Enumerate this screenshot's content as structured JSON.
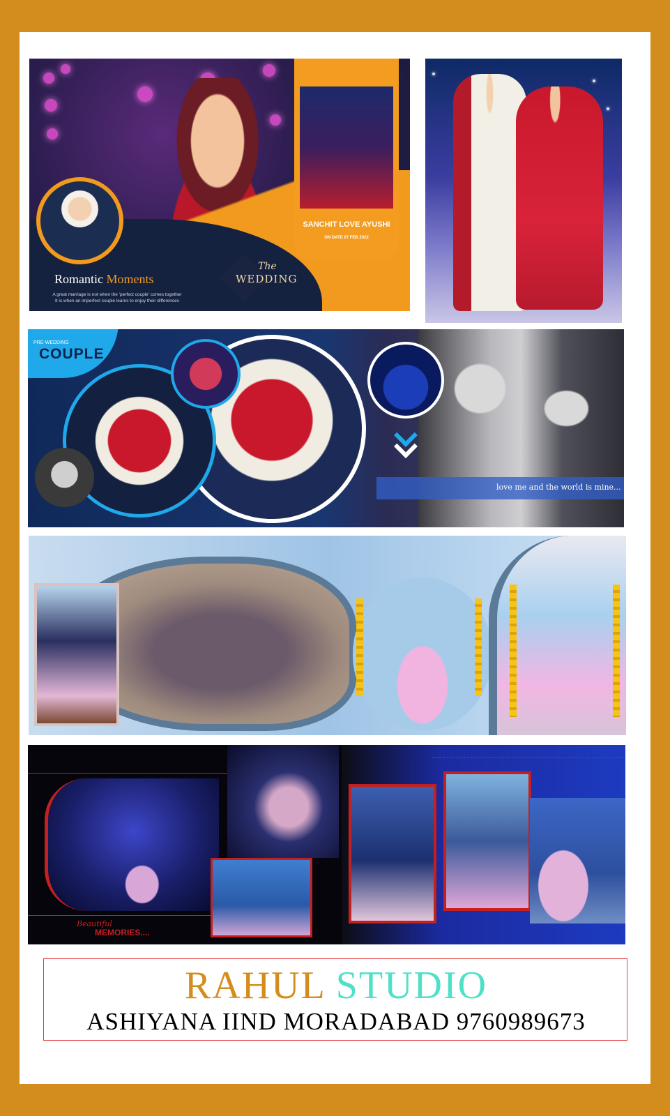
{
  "panel1": {
    "romantic_word": "Romantic",
    "moments_word": "Moments",
    "quote_line1": "A great marriage is not when the 'perfect couple' comes together",
    "quote_line2": "It is when an imperfect couple learns to enjoy their differences",
    "card_title": "SANCHIT LOVE AYUSHI",
    "card_date": "ON DATE 07 FEB 2022",
    "wedding_the": "The",
    "wedding_word": "WEDDING"
  },
  "panel3": {
    "pre_wedding": "PRE-WEDDING",
    "couple": "COUPLE",
    "love_text": "love me and the world is mine..."
  },
  "panel5": {
    "beautiful": "Beautiful",
    "memories": "MEMORIES...."
  },
  "footer": {
    "studio_word1": "RAHUL",
    "studio_word2": "STUDIO",
    "address": "ASHIYANA IIND MORADABAD 9760989673"
  },
  "colors": {
    "frame": "#d38d1c",
    "studio_orange": "#d38d1c",
    "studio_teal": "#4fe0c8",
    "accent_red": "#c42020",
    "accent_blue": "#1fa8ea"
  }
}
